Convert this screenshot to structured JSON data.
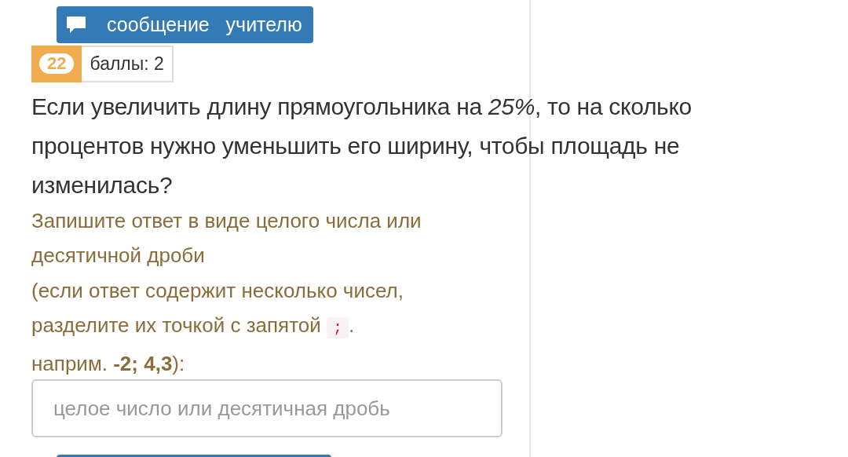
{
  "message_button": {
    "label": "сообщение   учителю"
  },
  "task": {
    "number": "22",
    "points": "баллы: 2"
  },
  "question": "Если увеличить длину прямоугольника на *25%*, то на сколько процентов нужно уменьшить его ширину, чтобы площадь не изменилась?",
  "instructions": {
    "hint": "Запишите ответ в виде целого числа или десятичной дроби",
    "note_lines": [
      "(если ответ содержит несколько чисел,",
      "разделите их точкой с запятой"
    ],
    "separator": ";",
    "note_end": ".",
    "example": "наприм. **-2; 4,3**):"
  },
  "answer_field": {
    "placeholder": "целое число или десятичная дробь"
  }
}
